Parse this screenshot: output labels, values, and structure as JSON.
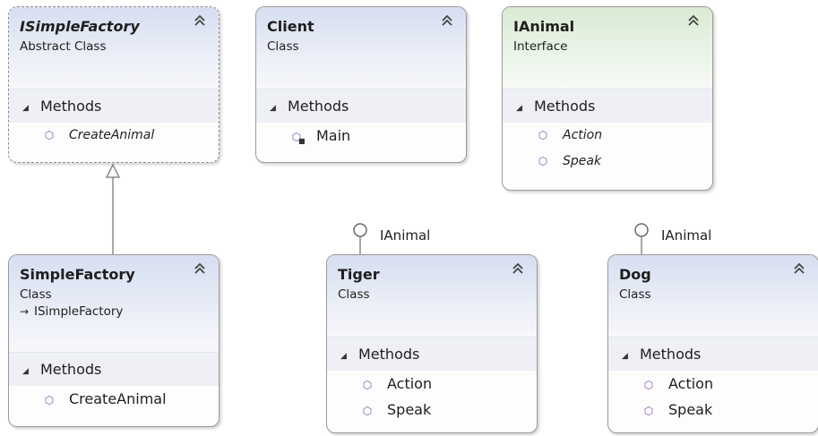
{
  "classes": {
    "isimplefactory": {
      "title": "ISimpleFactory",
      "kind": "Abstract Class",
      "section": "Methods",
      "methods": [
        "CreateAnimal"
      ]
    },
    "client": {
      "title": "Client",
      "kind": "Class",
      "section": "Methods",
      "methods": [
        "Main"
      ]
    },
    "ianimal": {
      "title": "IAnimal",
      "kind": "Interface",
      "section": "Methods",
      "methods": [
        "Action",
        "Speak"
      ]
    },
    "simplefactory": {
      "title": "SimpleFactory",
      "kind": "Class",
      "base": "ISimpleFactory",
      "section": "Methods",
      "methods": [
        "CreateAnimal"
      ]
    },
    "tiger": {
      "title": "Tiger",
      "kind": "Class",
      "section": "Methods",
      "methods": [
        "Action",
        "Speak"
      ],
      "interface_label": "IAnimal"
    },
    "dog": {
      "title": "Dog",
      "kind": "Class",
      "section": "Methods",
      "methods": [
        "Action",
        "Speak"
      ],
      "interface_label": "IAnimal"
    }
  },
  "icons": {
    "collapse": "double-chevron-up-icon",
    "section_toggle": "triangle-down-icon",
    "method": "method-cube-icon",
    "private_method": "method-lock-icon",
    "inheritance": "inheritance-arrow-icon"
  },
  "colors": {
    "class_header": "#d6def0",
    "interface_header": "#d9ebd4",
    "section_bg": "#eef0f6",
    "method_icon": "#7d4fb0",
    "border": "#9a9a9a"
  }
}
